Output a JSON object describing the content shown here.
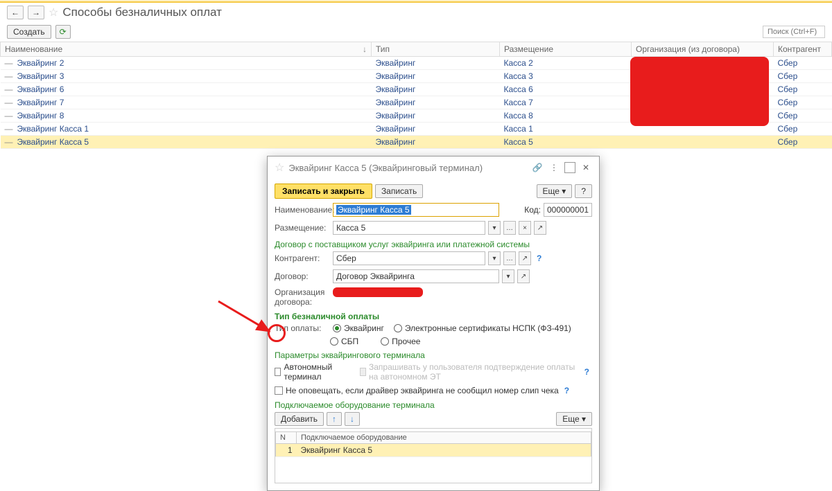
{
  "page": {
    "title": "Способы безналичных оплат"
  },
  "toolbar": {
    "create": "Создать"
  },
  "search": {
    "placeholder": "Поиск (Ctrl+F)"
  },
  "columns": {
    "name": "Наименование",
    "type": "Тип",
    "placement": "Размещение",
    "org": "Организация (из договора)",
    "counterparty": "Контрагент"
  },
  "rows": [
    {
      "name": "Эквайринг 2",
      "type": "Эквайринг",
      "placement": "Касса 2",
      "cp": "Сбер"
    },
    {
      "name": "Эквайринг 3",
      "type": "Эквайринг",
      "placement": "Касса 3",
      "cp": "Сбер"
    },
    {
      "name": "Эквайринг 6",
      "type": "Эквайринг",
      "placement": "Касса 6",
      "cp": "Сбер"
    },
    {
      "name": "Эквайринг 7",
      "type": "Эквайринг",
      "placement": "Касса 7",
      "cp": "Сбер"
    },
    {
      "name": "Эквайринг 8",
      "type": "Эквайринг",
      "placement": "Касса 8",
      "cp": "Сбер"
    },
    {
      "name": "Эквайринг Касса 1",
      "type": "Эквайринг",
      "placement": "Касса 1",
      "cp": "Сбер"
    },
    {
      "name": "Эквайринг Касса 5",
      "type": "Эквайринг",
      "placement": "Касса 5",
      "cp": "Сбер"
    }
  ],
  "dialog": {
    "title": "Эквайринг Касса 5 (Эквайринговый терминал)",
    "save_close": "Записать и закрыть",
    "save": "Записать",
    "more": "Еще",
    "labels": {
      "name": "Наименование:",
      "code": "Код:",
      "placement": "Размещение:",
      "counterparty": "Контрагент:",
      "contract": "Договор:",
      "org": "Организация договора:",
      "pay_type": "Тип оплаты:",
      "add": "Добавить"
    },
    "values": {
      "name": "Эквайринг Касса 5",
      "code": "000000001",
      "placement": "Касса 5",
      "counterparty": "Сбер",
      "contract": "Договор Эквайринга"
    },
    "sections": {
      "contract": "Договор с поставщиком услуг эквайринга или платежной системы",
      "pay_type": "Тип безналичной оплаты",
      "terminal_params": "Параметры эквайрингового терминала",
      "equipment": "Подключаемое оборудование терминала"
    },
    "radios": {
      "acquiring": "Эквайринг",
      "nspk": "Электронные сертификаты НСПК (ФЗ-491)",
      "sbp": "СБП",
      "other": "Прочее"
    },
    "checkboxes": {
      "autonomous": "Автономный терминал",
      "ask_confirm": "Запрашивать у пользователя подтверждение оплаты на автономном ЭТ",
      "no_notify": "Не оповещать, если драйвер эквайринга не сообщил номер слип чека"
    },
    "eq_columns": {
      "n": "N",
      "name": "Подключаемое оборудование"
    },
    "eq_rows": [
      {
        "n": "1",
        "name": "Эквайринг Касса 5"
      }
    ]
  }
}
